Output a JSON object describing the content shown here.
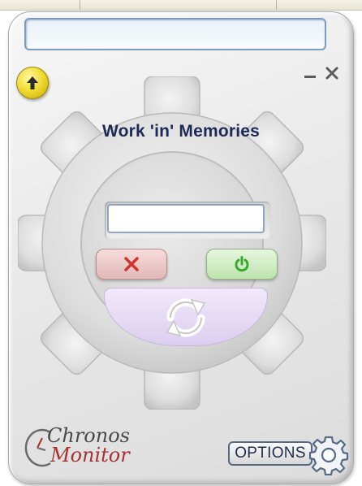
{
  "app": {
    "headline": "Work 'in' Memories",
    "title_field_value": "",
    "entry_field_value": ""
  },
  "toolbar": {
    "minimize_label": "–",
    "close_label": "×"
  },
  "logo": {
    "line1": "Chronos",
    "line2": "Monitor"
  },
  "options": {
    "label": "OPTIONS"
  },
  "icons": {
    "up": "arrow-up-icon",
    "cancel": "x-icon",
    "power": "power-icon",
    "refresh": "refresh-icon",
    "settings": "gear-icon"
  },
  "colors": {
    "headline": "#1d2a55",
    "up_button": "#f2dd35",
    "cancel_x": "#d0342c",
    "power": "#3aa82c",
    "refresh_bowl": "#e6dbf3",
    "logo_red": "#a83232"
  }
}
